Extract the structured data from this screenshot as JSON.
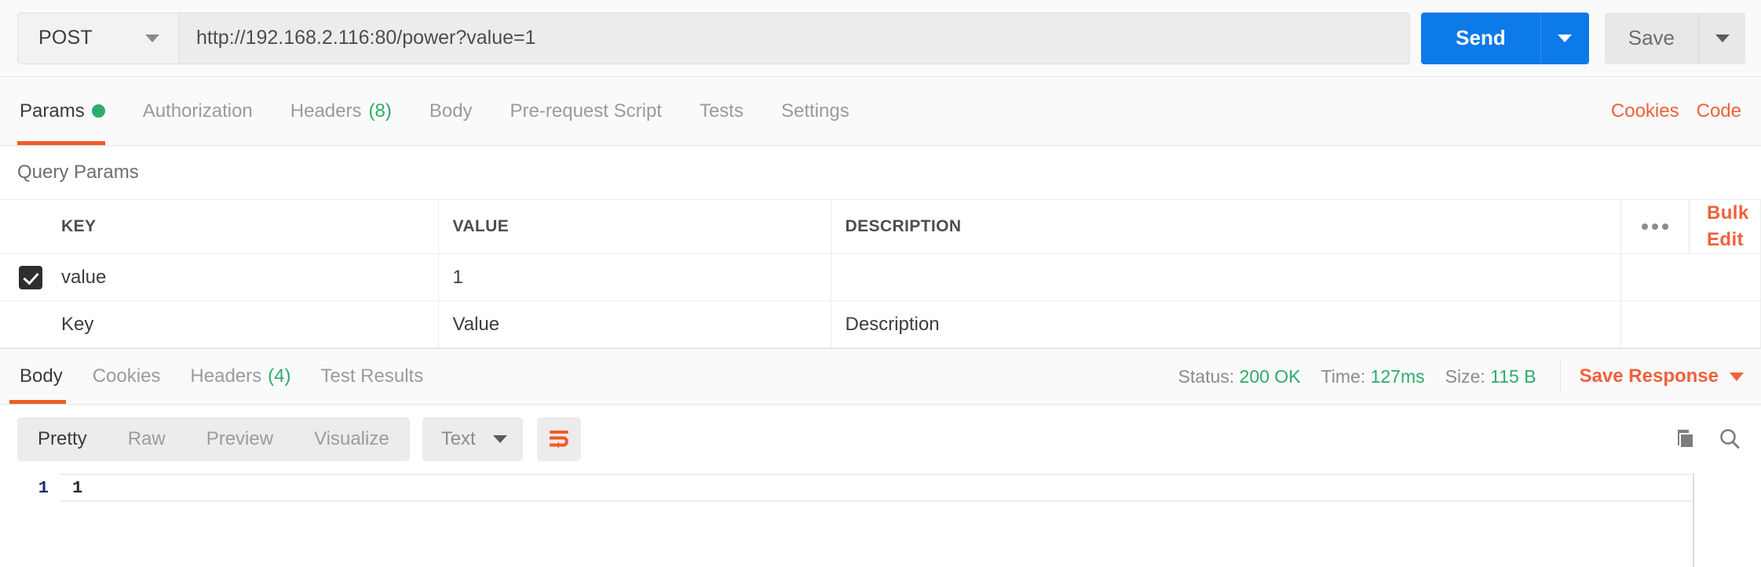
{
  "request": {
    "method": "POST",
    "url": "http://192.168.2.116:80/power?value=1",
    "send_label": "Send",
    "save_label": "Save"
  },
  "request_tabs": [
    {
      "label": "Params",
      "badge": "",
      "dot": true,
      "active": true
    },
    {
      "label": "Authorization",
      "badge": "",
      "dot": false,
      "active": false
    },
    {
      "label": "Headers",
      "badge": "(8)",
      "dot": false,
      "active": false
    },
    {
      "label": "Body",
      "badge": "",
      "dot": false,
      "active": false
    },
    {
      "label": "Pre-request Script",
      "badge": "",
      "dot": false,
      "active": false
    },
    {
      "label": "Tests",
      "badge": "",
      "dot": false,
      "active": false
    },
    {
      "label": "Settings",
      "badge": "",
      "dot": false,
      "active": false
    }
  ],
  "tabs_right": {
    "cookies": "Cookies",
    "code": "Code"
  },
  "query_params": {
    "title": "Query Params",
    "columns": [
      "KEY",
      "VALUE",
      "DESCRIPTION"
    ],
    "bulk_edit": "Bulk Edit",
    "rows": [
      {
        "checked": true,
        "key": "value",
        "value": "1",
        "description": ""
      }
    ],
    "new_row_placeholders": {
      "key": "Key",
      "value": "Value",
      "description": "Description"
    }
  },
  "response_tabs": [
    {
      "label": "Body",
      "badge": "",
      "active": true
    },
    {
      "label": "Cookies",
      "badge": "",
      "active": false
    },
    {
      "label": "Headers",
      "badge": "(4)",
      "active": false
    },
    {
      "label": "Test Results",
      "badge": "",
      "active": false
    }
  ],
  "response_status": {
    "status_label": "Status:",
    "status_value": "200 OK",
    "time_label": "Time:",
    "time_value": "127ms",
    "size_label": "Size:",
    "size_value": "115 B",
    "save_response": "Save Response"
  },
  "body_toolbar": {
    "views": [
      {
        "label": "Pretty",
        "active": true
      },
      {
        "label": "Raw",
        "active": false
      },
      {
        "label": "Preview",
        "active": false
      },
      {
        "label": "Visualize",
        "active": false
      }
    ],
    "format": "Text"
  },
  "response_body": {
    "lines": [
      {
        "number": "1",
        "text": "1"
      }
    ]
  },
  "colors": {
    "accent_orange": "#ef5b25",
    "link_orange": "#ef613c",
    "send_blue": "#0c7ae9",
    "status_green": "#2dab6a"
  }
}
